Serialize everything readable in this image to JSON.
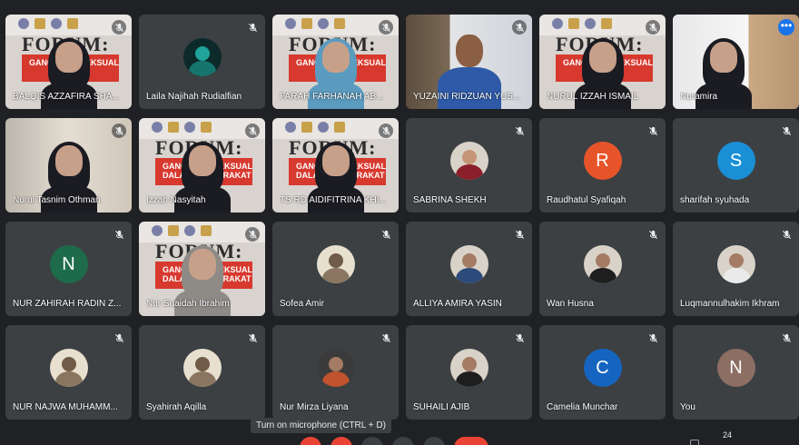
{
  "participants": [
    {
      "name": "BALQIS AZZAFIRA SHA...",
      "kind": "banner",
      "person": "hij-black",
      "banner_text": "GANGGUAN SEKSUAL"
    },
    {
      "name": "Laila Najihah Rudialfian",
      "kind": "avatar",
      "avatar": "av-teal"
    },
    {
      "name": "FARAH FARHANAH AB...",
      "kind": "banner",
      "person": "hij-blue",
      "banner_text": "GANGGUAN SEKSUAL"
    },
    {
      "name": "YUZAINI RIDZUAN YUS...",
      "kind": "office"
    },
    {
      "name": "NURUL IZZAH ISMAIL",
      "kind": "banner",
      "person": "hij-black",
      "banner_text": "GANGGUAN SEKSUAL"
    },
    {
      "name": "Nuramira",
      "kind": "white",
      "active": true
    },
    {
      "name": "Nurul Tasnim Othman",
      "kind": "room",
      "person": "hij-black"
    },
    {
      "name": "Izzah Nasyitah",
      "kind": "banner",
      "person": "hij-black",
      "banner_text": "GANGGUAN SEKSUAL DALAM MASYARAKAT"
    },
    {
      "name": "TS RD AIDIFITRINA KHI...",
      "kind": "banner",
      "person": "hij-black",
      "banner_text": "GANGGUAN SEKSUAL DALAM MASYARAKAT"
    },
    {
      "name": "SABRINA SHEKH",
      "kind": "avatar",
      "avatar": "av-hijab-red"
    },
    {
      "name": "Raudhatul Syafiqah",
      "kind": "letter",
      "letter": "R",
      "color": "#e8542a"
    },
    {
      "name": "sharifah syuhada",
      "kind": "letter",
      "letter": "S",
      "color": "#1a8fd6"
    },
    {
      "name": "NUR ZAHIRAH RADIN Z...",
      "kind": "letter",
      "letter": "N",
      "color": "#1e6b4a"
    },
    {
      "name": "Nur Suaidah Ibrahim",
      "kind": "banner",
      "person": "hij-grey",
      "banner_text": "GANGGUAN SEKSUAL DALAM MASYARAKAT"
    },
    {
      "name": "Sofea Amir",
      "kind": "avatar",
      "avatar": "av-cream"
    },
    {
      "name": "ALLIYA AMIRA YASIN",
      "kind": "avatar",
      "avatar": "av-blue"
    },
    {
      "name": "Wan Husna",
      "kind": "avatar",
      "avatar": "av-dark"
    },
    {
      "name": "Luqmannulhakim Ikhram",
      "kind": "avatar",
      "avatar": "av-white"
    },
    {
      "name": "NUR NAJWA MUHAMM...",
      "kind": "avatar",
      "avatar": "av-cream"
    },
    {
      "name": "Syahirah Aqilla",
      "kind": "avatar",
      "avatar": "av-cream"
    },
    {
      "name": "Nur Mirza Liyana",
      "kind": "avatar",
      "avatar": "av-colorful"
    },
    {
      "name": "SUHAILI AJIB",
      "kind": "avatar",
      "avatar": "av-dark"
    },
    {
      "name": "Camelia Munchar",
      "kind": "letter",
      "letter": "C",
      "color": "#1565c0"
    },
    {
      "name": "You",
      "kind": "letter",
      "letter": "N",
      "color": "#8d6e63"
    }
  ],
  "forum_word": "FORUM:",
  "tooltip": "Turn on microphone (CTRL + D)",
  "participant_count": "24",
  "more_options_glyph": "•••"
}
